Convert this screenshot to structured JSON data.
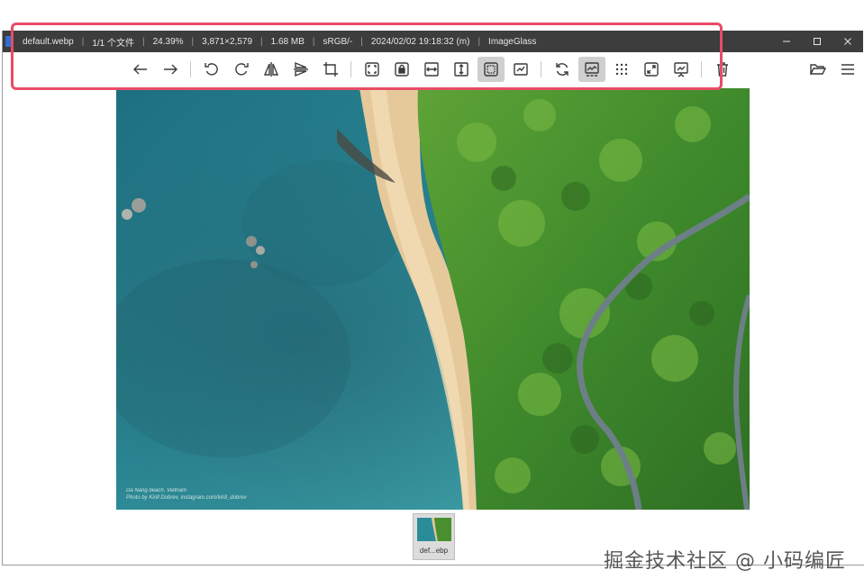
{
  "titlebar": {
    "filename": "default.webp",
    "file_index": "1/1 个文件",
    "zoom": "24.39%",
    "dimensions": "3,871×2,579",
    "filesize": "1.68 MB",
    "color_profile": "sRGB/-",
    "modified": "2024/02/02 19:18:32 (m)",
    "app_name": "ImageGlass",
    "separator": "|"
  },
  "toolbar": {
    "active_buttons": [
      "selection",
      "gallery"
    ]
  },
  "photo": {
    "credit_line1": "Da Nang beach, Vietnam",
    "credit_line2": "Photo by Kirill Dobrev, instagram.com/kirill_dobrev"
  },
  "thumbnail": {
    "label": "def...ebp"
  },
  "watermark": "掘金技术社区 @ 小码编匠",
  "colors": {
    "titlebar_bg": "#3d3d3d",
    "highlight": "#e84c66",
    "active_button_bg": "#cfcfcf"
  }
}
